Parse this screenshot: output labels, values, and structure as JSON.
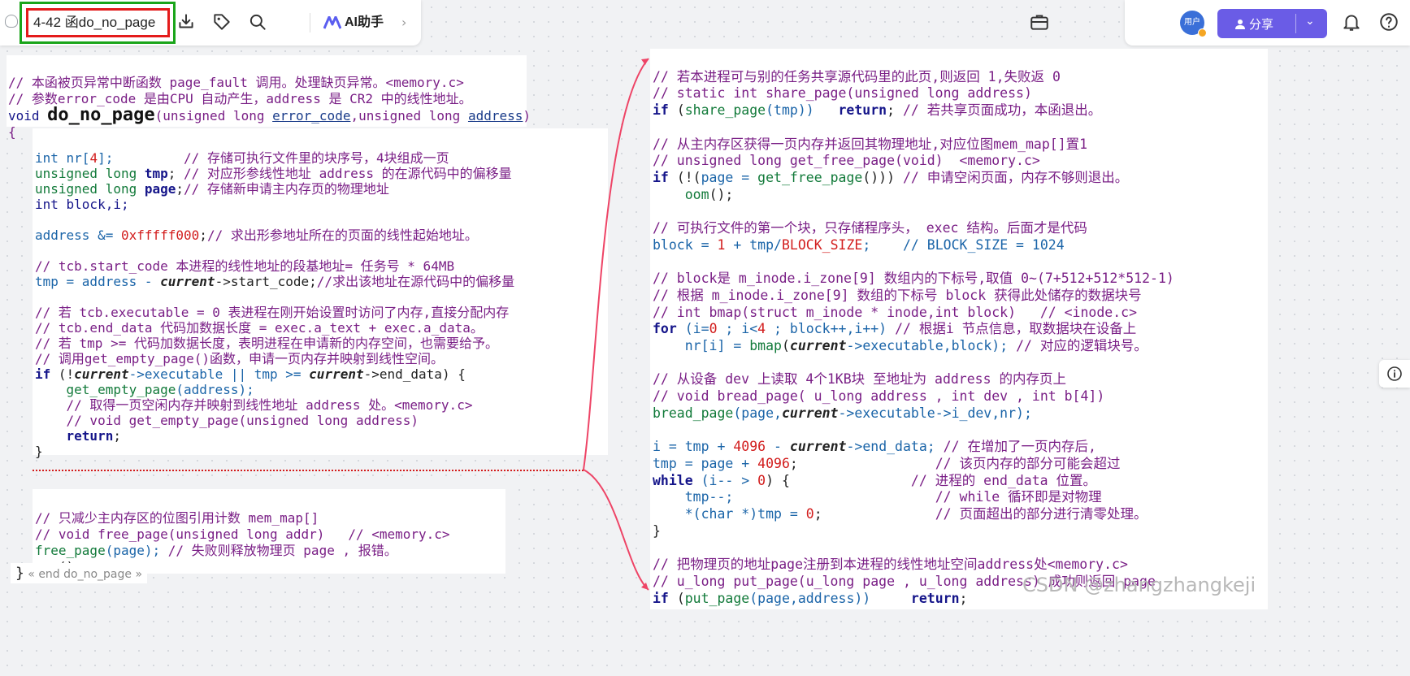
{
  "toolbar": {
    "doc_title": "4-42 函do_no_page",
    "ai_label": "AI助手",
    "avatar_label": "用户",
    "share_label": "分享"
  },
  "left_header": {
    "l1": "// 本函被页异常中断函数 page_fault 调用。处理缺页异常。<memory.c>",
    "l2": "// 参数error_code 是由CPU 自动产生，address 是 CR2 中的线性地址。",
    "sig_kw": "void ",
    "sig_name": "do_no_page",
    "sig_a": "(unsigned long ",
    "sig_p1": "error_code",
    "sig_b": ",unsigned long ",
    "sig_p2": "address",
    "sig_c": ")",
    "brace": "{"
  },
  "left_body": {
    "d1a": "int nr[",
    "d1n": "4",
    "d1b": "];         ",
    "d1c": "// 存储可执行文件里的块序号，4块组成一页",
    "d2a": "unsigned long ",
    "d2b": "tmp",
    "d2c": "; ",
    "d2d": "// 对应形参线性地址 address 的在源代码中的偏移量",
    "d3a": "unsigned long ",
    "d3b": "page",
    "d3c": ";",
    "d3d": "// 存储新申请主内存页的物理地址",
    "d4": "int block,i;",
    "a1": "address &= ",
    "a1n": "0xfffff000",
    "a1b": ";",
    "a1c": "// 求出形参地址所在的页面的线性起始地址。",
    "t1": "// tcb.start_code 本进程的线性地址的段基地址= 任务号 * 64MB",
    "t2a": "tmp = address - ",
    "t2b": "current",
    "t2c": "->start_code;",
    "t2d": "//求出该地址在源代码中的偏移量",
    "c1": "// 若 tcb.executable = 0 表进程在刚开始设置时访问了内存,直接分配内存",
    "c2": "// tcb.end_data 代码加数据长度 = exec.a_text + exec.a_data。",
    "c3": "// 若 tmp >= 代码加数据长度，表明进程在申请新的内存空间，也需要给予。",
    "c4": "// 调用get_empty_page()函数，申请一页内存并映射到线性空间。",
    "if_kw": "if ",
    "if_a": "(!",
    "if_b": "current",
    "if_c": "->executable || tmp >= ",
    "if_d": "current",
    "if_e": "->end_data) {",
    "g1": "get_empty_page",
    "g1b": "(address);",
    "g2": "// 取得一页空闲内存并映射到线性地址 address 处。<memory.c>",
    "g3": "// void get_empty_page(unsigned long address)",
    "ret": "return",
    "semi": ";",
    "close": "}"
  },
  "left_bottom": {
    "b1": "// 只减少主内存区的位图引用计数 mem_map[]",
    "b2": "// void free_page(unsigned long addr)   // <memory.c>",
    "b3a": "free_page",
    "b3b": "(page); ",
    "b3c": "// 失败则释放物理页 page , 报错。",
    "b4": "oom",
    "b4b": "();"
  },
  "end_tag": {
    "brace": "}",
    "text": "« end do_no_page »"
  },
  "right": {
    "r1": "// 若本进程可与别的任务共享源代码里的此页,则返回 1,失败返 0",
    "r2": "// static int share_page(unsigned long address)",
    "r3kw": "if ",
    "r3a": "(",
    "r3b": "share_page",
    "r3c": "(tmp))   ",
    "r3d": "return",
    "r3e": "; ",
    "r3f": "// 若共享页面成功，本函退出。",
    "r4": "// 从主内存区获得一页内存并返回其物理地址,对应位图mem_map[]置1",
    "r5": "// unsigned long get_free_page(void)  <memory.c>",
    "r6kw": "if ",
    "r6a": "(!(",
    "r6b": "page = ",
    "r6c": "get_free_page",
    "r6d": "())) ",
    "r6e": "// 申请空闲页面，内存不够则退出。",
    "r7": "oom",
    "r7b": "();",
    "r8": "// 可执行文件的第一个块，只存储程序头， exec 结构。后面才是代码",
    "r9a": "block = ",
    "r9b": "1",
    "r9c": " + tmp/",
    "r9d": "BLOCK_SIZE",
    "r9e": ";    // BLOCK_SIZE = 1024",
    "r10": "// block是 m_inode.i_zone[9] 数组内的下标号,取值 0~(7+512+512*512-1)",
    "r11": "// 根据 m_inode.i_zone[9] 数组的下标号 block 获得此处储存的数据块号",
    "r12": "// int bmap(struct m_inode * inode,int block)   // <inode.c>",
    "r13kw": "for ",
    "r13a": "(i=",
    "r13b": "0",
    "r13c": " ; i<",
    "r13d": "4",
    "r13e": " ; block++,i++) ",
    "r13f": "// 根据i 节点信息，取数据块在设备上",
    "r14a": "nr[i] = ",
    "r14b": "bmap",
    "r14c": "(",
    "r14d": "current",
    "r14e": "->executable,block); ",
    "r14f": "// 对应的逻辑块号。",
    "r15": "// 从设备 dev 上读取 4个1KB块 至地址为 address 的内存页上",
    "r16": "// void bread_page( u_long address , int dev , int b[4])",
    "r17a": "bread_page",
    "r17b": "(page,",
    "r17c": "current",
    "r17d": "->executable->i_dev,nr);",
    "r18a": "i = tmp + ",
    "r18b": "4096",
    "r18c": " - ",
    "r18d": "current",
    "r18e": "->end_data; ",
    "r18f": "// 在增加了一页内存后,",
    "r19a": "tmp = page + ",
    "r19b": "4096",
    "r19c": ";                 ",
    "r19d": "// 该页内存的部分可能会超过",
    "r20kw": "while",
    "r20a": " (i-- > ",
    "r20b": "0",
    "r20c": ") {               ",
    "r20d": "// 进程的 end_data 位置。",
    "r21a": "tmp--;",
    "r21b": "                         ",
    "r21c": "// while 循环即是对物理",
    "r22a": "*(char *)tmp = ",
    "r22b": "0",
    "r22c": ";              ",
    "r22d": "// 页面超出的部分进行清零处理。",
    "r23": "}",
    "r24": "// 把物理页的地址page注册到本进程的线性地址空间address处<memory.c>",
    "r25": "// u_long put_page(u_long page , u_long address) 成功则返回 page",
    "r26kw": "if ",
    "r26a": "(",
    "r26b": "put_page",
    "r26c": "(page,address))     ",
    "r26d": "return",
    "r26e": ";"
  },
  "watermark": "CSDN @zhangzhangkeji"
}
